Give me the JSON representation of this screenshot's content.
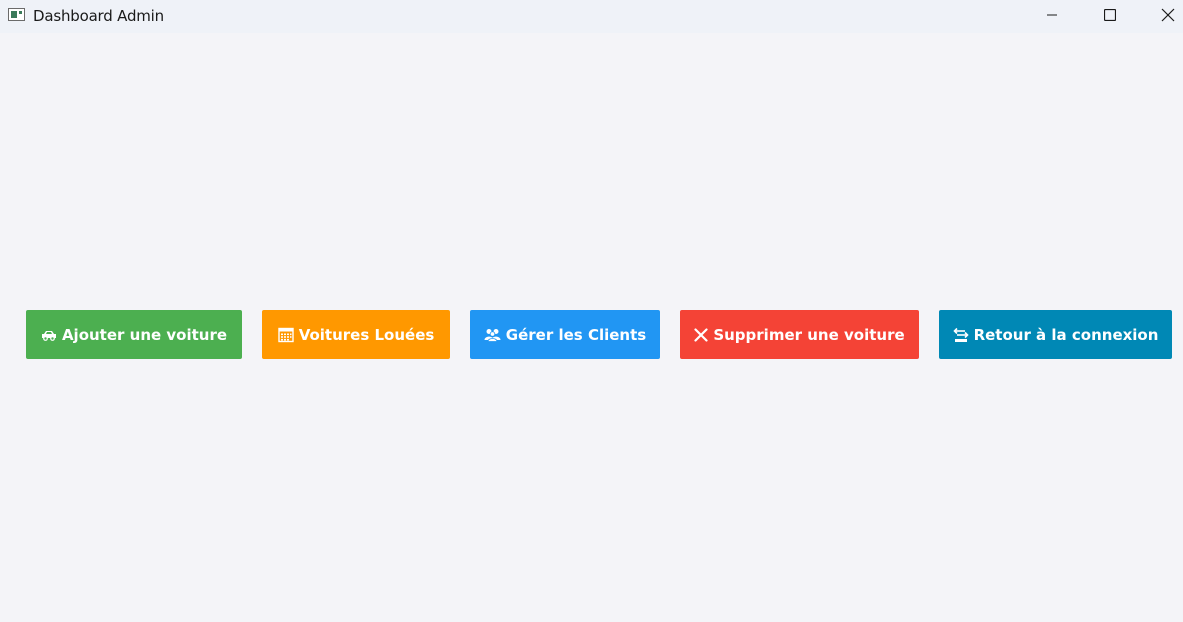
{
  "window": {
    "title": "Dashboard Admin",
    "controls": {
      "minimize": "minimize-icon",
      "maximize": "maximize-icon",
      "close": "close-icon"
    }
  },
  "actions": [
    {
      "label": "Ajouter une voiture",
      "icon": "car-icon",
      "color": "#4caf50"
    },
    {
      "label": "Voitures Louées",
      "icon": "calendar-icon",
      "color": "#ff9800"
    },
    {
      "label": "Gérer les Clients",
      "icon": "users-icon",
      "color": "#2196f3"
    },
    {
      "label": "Supprimer une voiture",
      "icon": "cross-icon",
      "color": "#f44336"
    },
    {
      "label": "Retour à la connexion",
      "icon": "back-icon",
      "color": "#0088b5"
    }
  ]
}
